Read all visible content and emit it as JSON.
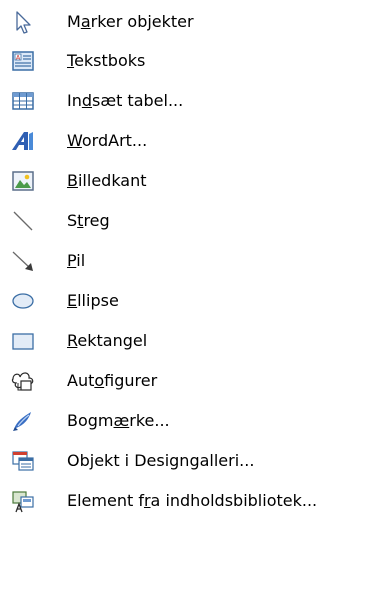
{
  "menu": {
    "items": [
      {
        "name": "select-objects",
        "pre": "M",
        "acc": "a",
        "post": "rker objekter",
        "icon": "arrow-pointer-icon"
      },
      {
        "name": "text-box",
        "pre": "",
        "acc": "T",
        "post": "ekstboks",
        "icon": "text-box-icon"
      },
      {
        "name": "insert-table",
        "pre": "In",
        "acc": "d",
        "post": "sæt tabel...",
        "icon": "table-icon"
      },
      {
        "name": "wordart",
        "pre": "",
        "acc": "W",
        "post": "ordArt...",
        "icon": "wordart-icon"
      },
      {
        "name": "picture-frame",
        "pre": "",
        "acc": "B",
        "post": "illedkant",
        "icon": "picture-icon"
      },
      {
        "name": "line",
        "pre": "S",
        "acc": "t",
        "post": "reg",
        "icon": "line-icon"
      },
      {
        "name": "arrow",
        "pre": "",
        "acc": "P",
        "post": "il",
        "icon": "arrow-icon"
      },
      {
        "name": "ellipse",
        "pre": "",
        "acc": "E",
        "post": "llipse",
        "icon": "ellipse-icon"
      },
      {
        "name": "rectangle",
        "pre": "",
        "acc": "R",
        "post": "ektangel",
        "icon": "rectangle-icon"
      },
      {
        "name": "autoshapes",
        "pre": "Aut",
        "acc": "o",
        "post": "figurer",
        "icon": "autoshapes-icon"
      },
      {
        "name": "bookmark",
        "pre": "Bogm",
        "acc": "æ",
        "post": "rke...",
        "icon": "bookmark-icon"
      },
      {
        "name": "design-gallery-object",
        "pre": "Ob",
        "acc": "j",
        "post": "ekt i Designgalleri...",
        "icon": "design-gallery-icon"
      },
      {
        "name": "content-library-item",
        "pre": "Element f",
        "acc": "r",
        "post": "a indholdsbibliotek...",
        "icon": "content-library-icon"
      }
    ]
  }
}
